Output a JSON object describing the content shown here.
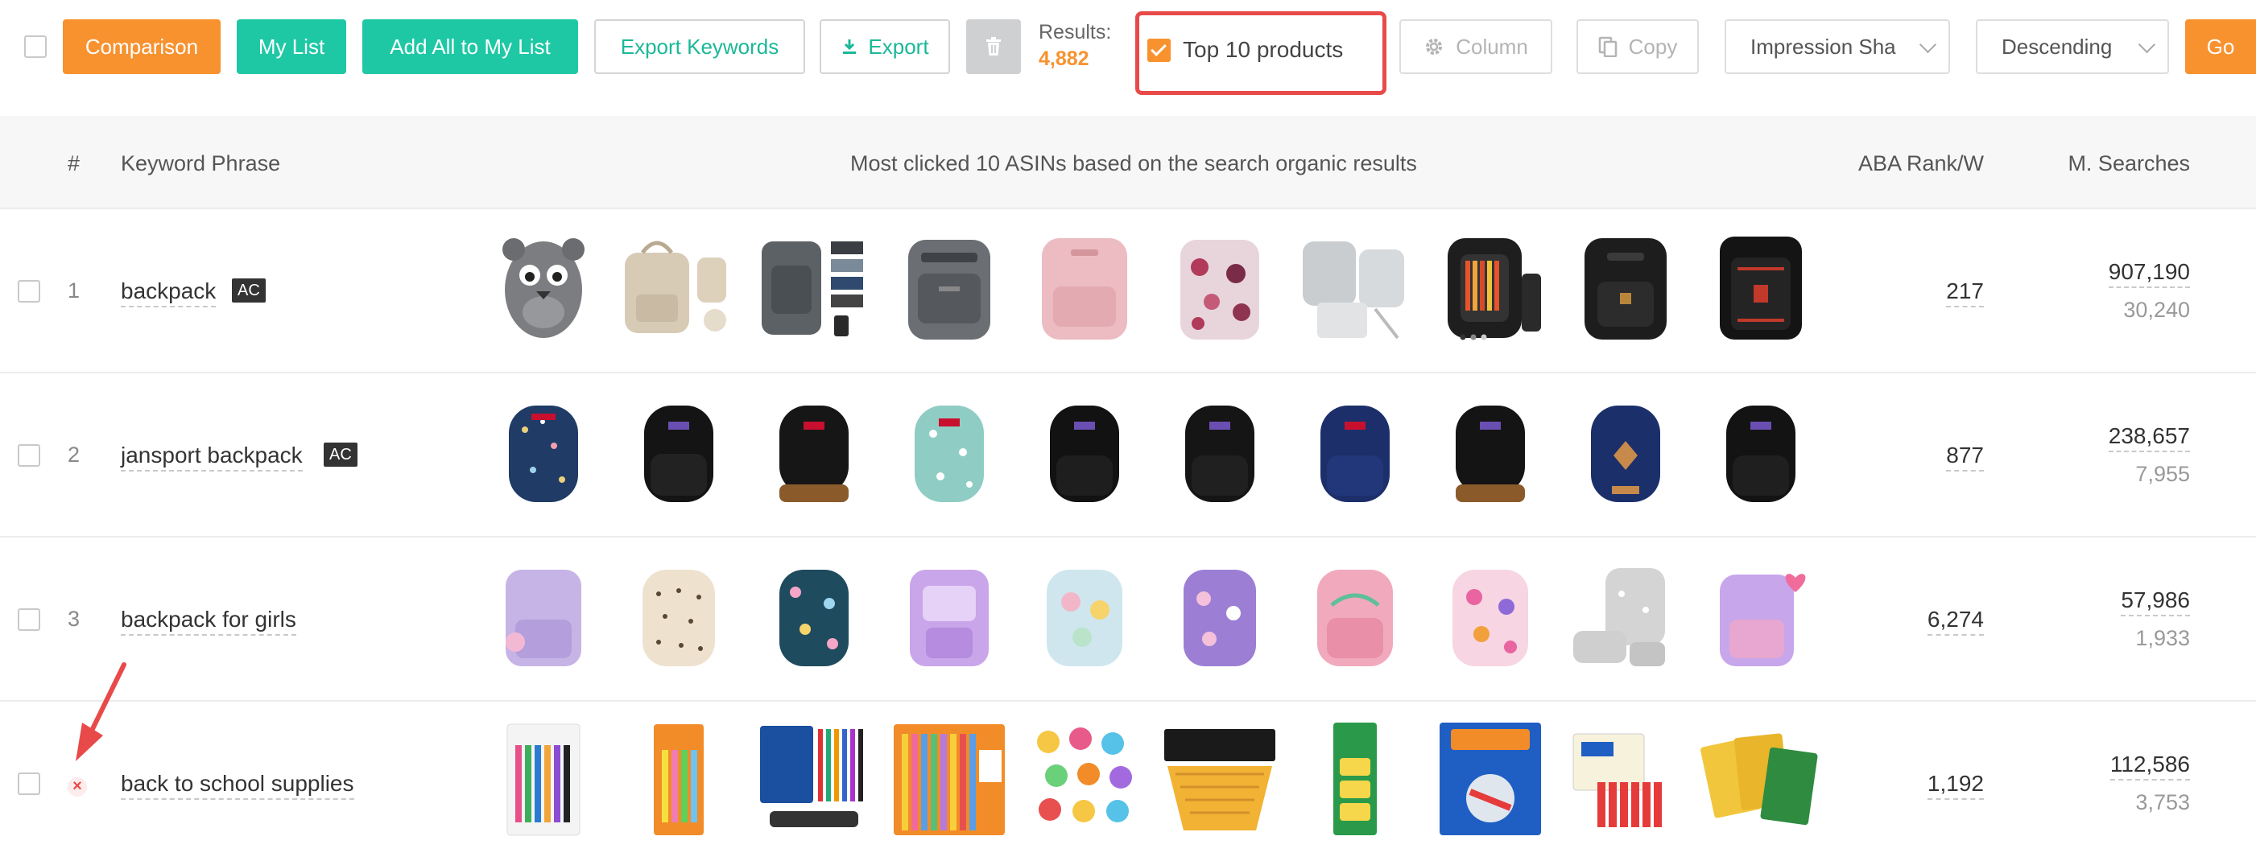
{
  "toolbar": {
    "comparison": "Comparison",
    "my_list": "My List",
    "add_all": "Add All to My List",
    "export_keywords": "Export Keywords",
    "export": "Export",
    "results_label": "Results:",
    "results_value": "4,882",
    "top10_label": "Top 10 products",
    "top10_checked": true,
    "column": "Column",
    "copy": "Copy",
    "sort_field": "Impression Sha",
    "sort_order": "Descending",
    "go": "Go"
  },
  "table": {
    "headers": {
      "index": "#",
      "keyword": "Keyword Phrase",
      "products": "Most clicked 10 ASINs based on the search organic results",
      "aba": "ABA Rank/W",
      "searches": "M. Searches"
    },
    "rows": [
      {
        "rank": "1",
        "keyword": "backpack",
        "badge": "AC",
        "aba": "217",
        "searches": "907,190",
        "searches_sub": "30,240"
      },
      {
        "rank": "2",
        "keyword": "jansport backpack",
        "badge": "AC",
        "aba": "877",
        "searches": "238,657",
        "searches_sub": "7,955"
      },
      {
        "rank": "3",
        "keyword": "backpack for girls",
        "badge": "",
        "aba": "6,274",
        "searches": "57,986",
        "searches_sub": "1,933"
      },
      {
        "rank": "",
        "keyword": "back to school supplies",
        "badge": "",
        "aba": "1,192",
        "searches": "112,586",
        "searches_sub": "3,753",
        "remove_icon": "close-icon"
      }
    ]
  },
  "colors": {
    "orange": "#f7922f",
    "teal": "#1ec8a4",
    "highlight_red": "#e84a4a"
  },
  "icons": {
    "export": "download-icon",
    "trash": "trash-icon",
    "column": "gear-icon",
    "copy": "copy-icon",
    "annotation": "red-arrow"
  }
}
